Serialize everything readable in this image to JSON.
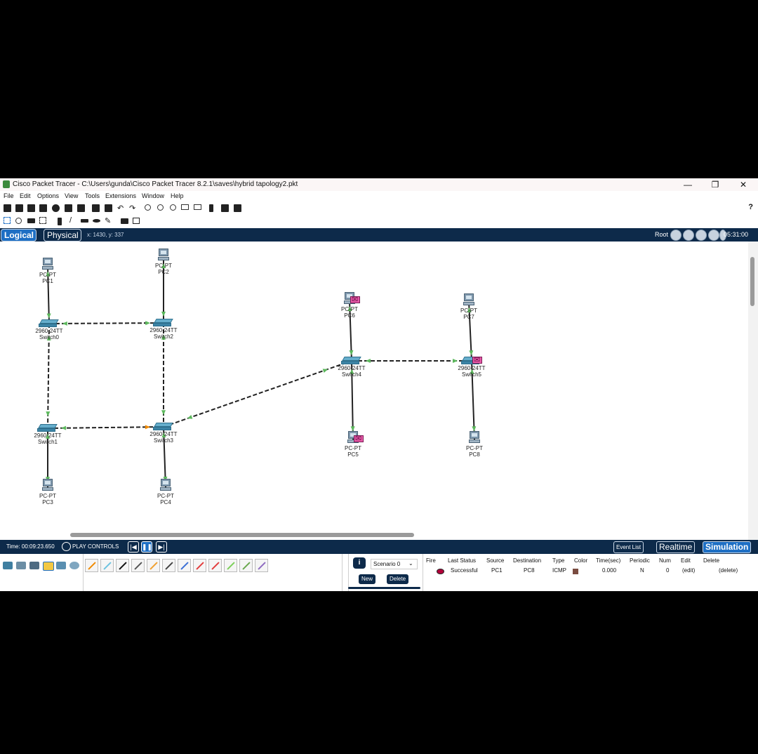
{
  "window": {
    "title": "Cisco Packet Tracer - C:\\Users\\gunda\\Cisco Packet Tracer 8.2.1\\saves\\hybrid tapology2.pkt",
    "minimize_label": "—",
    "restore_label": "❐",
    "close_label": "✕"
  },
  "menu": {
    "items": [
      "File",
      "Edit",
      "Options",
      "View",
      "Tools",
      "Extensions",
      "Window",
      "Help"
    ]
  },
  "toolbar": {
    "help_label": "?"
  },
  "navbar": {
    "logical_label": "Logical",
    "physical_label": "Physical",
    "coords": "x: 1430, y: 337",
    "root_label": "Root",
    "clock": "05:31:00"
  },
  "devices": [
    {
      "id": "pc1",
      "type": "pc",
      "model": "PC-PT",
      "name": "PC1",
      "envelope": false
    },
    {
      "id": "pc2",
      "type": "pc",
      "model": "PC-PT",
      "name": "PC2",
      "envelope": false
    },
    {
      "id": "pc3",
      "type": "pc",
      "model": "PC-PT",
      "name": "PC3",
      "envelope": false
    },
    {
      "id": "pc4",
      "type": "pc",
      "model": "PC-PT",
      "name": "PC4",
      "envelope": false
    },
    {
      "id": "pc5",
      "type": "pc",
      "model": "PC-PT",
      "name": "PC5",
      "envelope": true
    },
    {
      "id": "pc6",
      "type": "pc",
      "model": "PC-PT",
      "name": "PC6",
      "envelope": true
    },
    {
      "id": "pc7",
      "type": "pc",
      "model": "PC-PT",
      "name": "PC7",
      "envelope": false
    },
    {
      "id": "pc8",
      "type": "pc",
      "model": "PC-PT",
      "name": "PC8",
      "envelope": false
    },
    {
      "id": "switch0",
      "type": "switch",
      "model": "2960-24TT",
      "name": "Switch0",
      "envelope": false
    },
    {
      "id": "switch1",
      "type": "switch",
      "model": "2960-24TT",
      "name": "Switch1",
      "envelope": false
    },
    {
      "id": "switch2",
      "type": "switch",
      "model": "2960-24TT",
      "name": "Switch2",
      "envelope": false
    },
    {
      "id": "switch3",
      "type": "switch",
      "model": "2960-24TT",
      "name": "Switch3",
      "envelope": false
    },
    {
      "id": "switch4",
      "type": "switch",
      "model": "2960-24TT",
      "name": "Switch4",
      "envelope": false
    },
    {
      "id": "switch5",
      "type": "switch",
      "model": "2960-24TT",
      "name": "Switch5",
      "envelope": true
    }
  ],
  "links": [
    {
      "from": "pc1",
      "to": "switch0",
      "kind": "straight"
    },
    {
      "from": "pc2",
      "to": "switch2",
      "kind": "straight"
    },
    {
      "from": "pc3",
      "to": "switch1",
      "kind": "straight"
    },
    {
      "from": "pc4",
      "to": "switch3",
      "kind": "straight"
    },
    {
      "from": "pc6",
      "to": "switch4",
      "kind": "straight"
    },
    {
      "from": "pc5",
      "to": "switch4",
      "kind": "straight"
    },
    {
      "from": "pc7",
      "to": "switch5",
      "kind": "straight"
    },
    {
      "from": "pc8",
      "to": "switch5",
      "kind": "straight"
    },
    {
      "from": "switch0",
      "to": "switch2",
      "kind": "crossover"
    },
    {
      "from": "switch0",
      "to": "switch1",
      "kind": "crossover"
    },
    {
      "from": "switch2",
      "to": "switch3",
      "kind": "crossover"
    },
    {
      "from": "switch1",
      "to": "switch3",
      "kind": "crossover"
    },
    {
      "from": "switch3",
      "to": "switch4",
      "kind": "crossover"
    },
    {
      "from": "switch4",
      "to": "switch5",
      "kind": "crossover"
    }
  ],
  "status": {
    "time": "Time: 00:09:23.650",
    "play_controls": "PLAY CONTROLS",
    "back_label": "|◀",
    "pause_label": "❚❚",
    "forward_label": "▶|",
    "event_list": "Event List",
    "realtime": "Realtime",
    "simulation": "Simulation"
  },
  "scenario": {
    "selected": "Scenario 0",
    "new_label": "New",
    "delete_label": "Delete",
    "info_label": "i"
  },
  "pdu_table": {
    "headers": [
      "Fire",
      "Last Status",
      "Source",
      "Destination",
      "Type",
      "Color",
      "Time(sec)",
      "Periodic",
      "Num",
      "Edit",
      "Delete"
    ],
    "row": {
      "last_status": "Successful",
      "source": "PC1",
      "destination": "PC8",
      "type": "ICMP",
      "color": "#7a4c40",
      "time": "0.000",
      "periodic": "N",
      "num": "0",
      "edit": "(edit)",
      "delete": "(delete)"
    }
  },
  "colors": {
    "accent": "#1e6fc4",
    "navbar": "#0d2a4a",
    "link_up": "#5cb85c",
    "envelope": "#e85aa8"
  }
}
